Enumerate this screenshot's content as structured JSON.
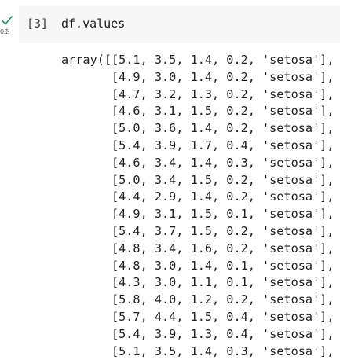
{
  "cell": {
    "status_icon": "check-icon",
    "status_color": "#0f9d58",
    "exec_time": "0초",
    "exec_count": "[3]",
    "code": "df.values"
  },
  "output": {
    "lines": [
      "array([[5.1, 3.5, 1.4, 0.2, 'setosa'],",
      "       [4.9, 3.0, 1.4, 0.2, 'setosa'],",
      "       [4.7, 3.2, 1.3, 0.2, 'setosa'],",
      "       [4.6, 3.1, 1.5, 0.2, 'setosa'],",
      "       [5.0, 3.6, 1.4, 0.2, 'setosa'],",
      "       [5.4, 3.9, 1.7, 0.4, 'setosa'],",
      "       [4.6, 3.4, 1.4, 0.3, 'setosa'],",
      "       [5.0, 3.4, 1.5, 0.2, 'setosa'],",
      "       [4.4, 2.9, 1.4, 0.2, 'setosa'],",
      "       [4.9, 3.1, 1.5, 0.1, 'setosa'],",
      "       [5.4, 3.7, 1.5, 0.2, 'setosa'],",
      "       [4.8, 3.4, 1.6, 0.2, 'setosa'],",
      "       [4.8, 3.0, 1.4, 0.1, 'setosa'],",
      "       [4.3, 3.0, 1.1, 0.1, 'setosa'],",
      "       [5.8, 4.0, 1.2, 0.2, 'setosa'],",
      "       [5.7, 4.4, 1.5, 0.4, 'setosa'],",
      "       [5.4, 3.9, 1.3, 0.4, 'setosa'],",
      "       [5.1, 3.5, 1.4, 0.3, 'setosa'],"
    ]
  }
}
